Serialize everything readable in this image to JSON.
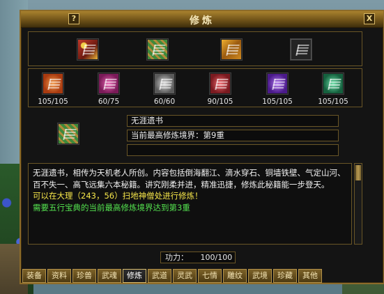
{
  "window": {
    "title": "修炼",
    "help_label": "?",
    "close_label": "X"
  },
  "top_slots": [
    {
      "icon": "book-stack-icon",
      "color": "#c23a2a",
      "filled": true
    },
    {
      "icon": "scroll-bundle-icon",
      "color": "#3e8a3b",
      "filled": true
    },
    {
      "icon": "treasure-box-icon",
      "color": "#d08a20",
      "filled": true
    },
    {
      "icon": "empty-slot-icon",
      "color": "#2a2a2a",
      "filled": false
    }
  ],
  "book_slots": [
    {
      "icon": "martial-book-icon",
      "color": "#e0661f",
      "count": "105/105"
    },
    {
      "icon": "martial-book-icon",
      "color": "#c8388c",
      "count": "60/75"
    },
    {
      "icon": "martial-book-icon",
      "color": "#a0a0a0",
      "count": "60/60"
    },
    {
      "icon": "martial-book-icon",
      "color": "#c8333a",
      "count": "90/105"
    },
    {
      "icon": "martial-book-icon",
      "color": "#7a3ac8",
      "count": "105/105"
    },
    {
      "icon": "martial-book-icon",
      "color": "#2a9a6a",
      "count": "105/105"
    }
  ],
  "selected": {
    "icon": "scroll-bundle-icon",
    "name": "无涯遗书",
    "level": "当前最高修炼境界：第9重",
    "extra": ""
  },
  "description": {
    "text": "无涯遗书，相传为天机老人所创。内容包括倒海翻江、滴水穿石、铜墙铁壁、气定山河、百不失一、高飞远集六本秘籍。讲究刚柔并进，精准迅捷，修炼此秘籍能一步登天。",
    "location": "可以在大理（243，56）扫地神僧处进行修炼！",
    "requirement": "需要五行宝典的当前最高修炼境界达到第3重"
  },
  "power": {
    "label": "功力：",
    "value": "100/100"
  },
  "tabs": [
    "装备",
    "资料",
    "珍兽",
    "武魂",
    "修炼",
    "武道",
    "灵武",
    "七情",
    "雕纹",
    "武境",
    "珍藏",
    "其他"
  ],
  "active_tab": "修炼"
}
